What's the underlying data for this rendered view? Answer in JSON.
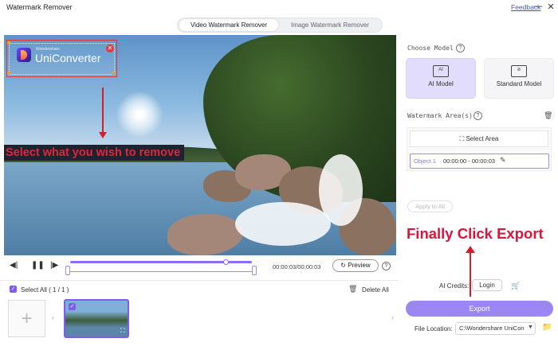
{
  "app": {
    "title": "Watermark Remover",
    "feedback": "Feedback"
  },
  "window_controls": {
    "minimize": "—",
    "maximize": "☐",
    "close": "✕"
  },
  "tabs": [
    {
      "label": "Video Watermark Remover",
      "active": true
    },
    {
      "label": "Image Watermark Remover",
      "active": false
    }
  ],
  "video": {
    "watermark_brand_small": "Wondershare",
    "watermark_brand": "UniConverter",
    "watermark_close": "✕",
    "instruction": "Select what you wish to remove"
  },
  "player": {
    "rewind": "◀|",
    "pause": "❚❚",
    "forward": "|▶",
    "progress": 0.86,
    "time": "00:00:03/00:00:03",
    "preview_label": "Preview",
    "preview_icon": "↻",
    "help": "?"
  },
  "file_list": {
    "select_all": "Select All ( 1 / 1 )",
    "delete_all": "Delete All",
    "add": "+",
    "prev": "‹",
    "next": "›",
    "check": "✓",
    "expand": "⛶"
  },
  "right_panel": {
    "choose_model_title": "Choose Model",
    "help": "?",
    "models": [
      {
        "label": "AI Model",
        "icon_text": "AI",
        "selected": true
      },
      {
        "label": "Standard Model",
        "icon_text": "⊘",
        "selected": false
      }
    ],
    "watermark_area_title": "Watermark Area(s)",
    "select_area": "Select Area",
    "select_area_icon": "⛶",
    "object": {
      "name": "Object 1",
      "time": "00:00:00 - 00:00:03",
      "edit_icon": "✎"
    },
    "apply_all": "Apply to All",
    "instruction": "Finally Click Export",
    "ai_credits_label": "AI Credits:",
    "login": "Login",
    "cart_icon": "🛒",
    "export": "Export",
    "file_location_label": "File Location:",
    "file_location_value": "C:\\Wondershare UniCon",
    "folder_icon": "📁",
    "trash_icon": "🗑"
  },
  "colors": {
    "accent": "#7e5cf0",
    "export": "#9b86f2",
    "annotation": "#d9163a"
  }
}
